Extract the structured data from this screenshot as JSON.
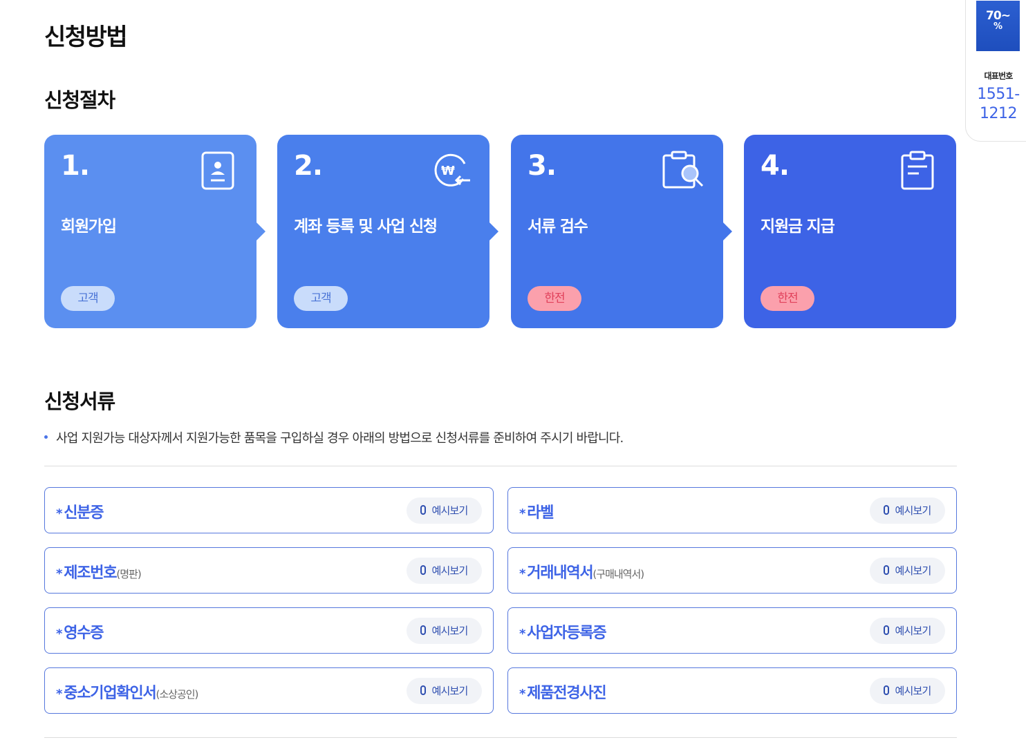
{
  "page": {
    "title": "신청방법"
  },
  "procedure": {
    "title": "신청절차",
    "steps": [
      {
        "num": "1.",
        "title": "회원가입",
        "badge": "고객",
        "icon": "id-card-icon"
      },
      {
        "num": "2.",
        "title": "계좌 등록 및 사업 신청",
        "badge": "고객",
        "icon": "won-transfer-icon"
      },
      {
        "num": "3.",
        "title": "서류 검수",
        "badge": "한전",
        "icon": "clipboard-search-icon"
      },
      {
        "num": "4.",
        "title": "지원금 지급",
        "badge": "한전",
        "icon": "clipboard-icon"
      }
    ]
  },
  "documents": {
    "title": "신청서류",
    "description": "사업 지원가능 대상자께서 지원가능한 품목을 구입하실 경우 아래의 방법으로 신청서류를 준비하여 주시기 바랍니다.",
    "required_mark": "*",
    "view_label": "예시보기",
    "items": [
      {
        "name": "신분증",
        "sub": ""
      },
      {
        "name": "라벨",
        "sub": ""
      },
      {
        "name": "제조번호",
        "sub": "(명판)"
      },
      {
        "name": "거래내역서",
        "sub": "(구매내역서)"
      },
      {
        "name": "영수증",
        "sub": ""
      },
      {
        "name": "사업자등록증",
        "sub": ""
      },
      {
        "name": "중소기업확인서",
        "sub": "(소상공인)"
      },
      {
        "name": "제품전경사진",
        "sub": ""
      }
    ]
  },
  "side_widget": {
    "promo_line1": "70~",
    "promo_line2": "%",
    "label": "대표번호",
    "phone_line1": "1551-",
    "phone_line2": "1212"
  },
  "colors": {
    "accent": "#3d63e6",
    "step1": "#5b8ff0",
    "step2": "#4a7fec",
    "step3": "#4375ea",
    "step4": "#3d63e6",
    "badge_customer": "#c9dcfb",
    "badge_kepco": "#fba0ac"
  }
}
